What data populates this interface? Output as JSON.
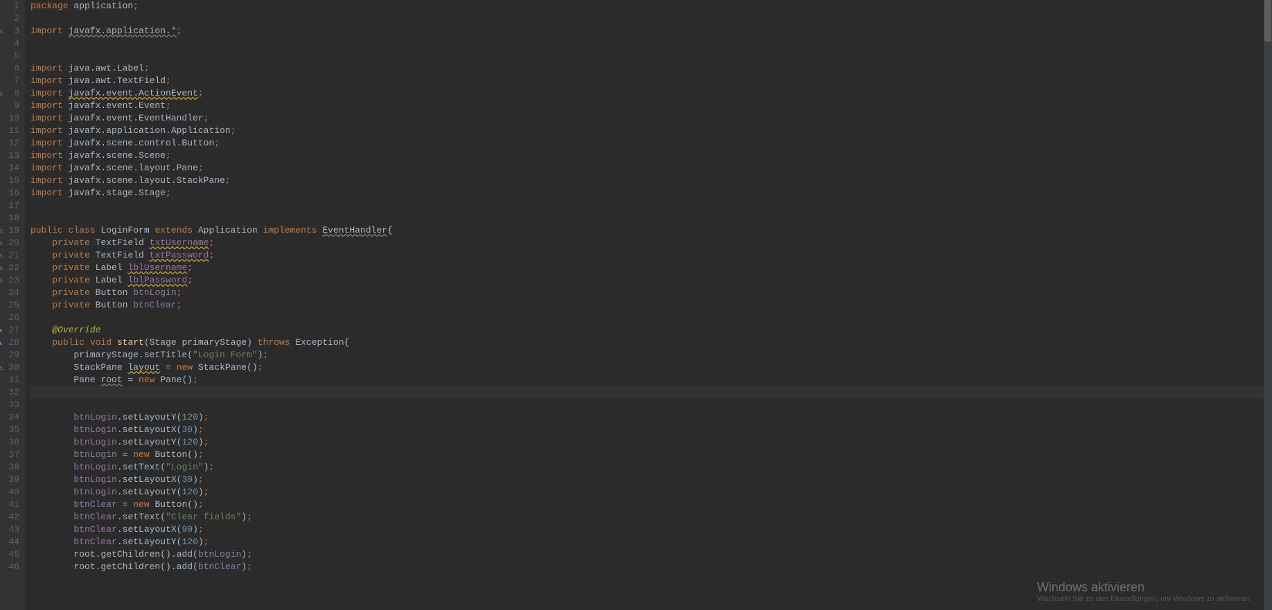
{
  "watermark": {
    "title": "Windows aktivieren",
    "subtitle": "Wechseln Sie zu den Einstellungen, um Windows zu aktivieren."
  },
  "lines": [
    {
      "n": 1,
      "tokens": [
        {
          "t": "package ",
          "c": "kw"
        },
        {
          "t": "application",
          "c": "type"
        },
        {
          "t": ";",
          "c": "semi"
        }
      ]
    },
    {
      "n": 2,
      "tokens": []
    },
    {
      "n": 3,
      "icon": "warn breakpoint",
      "tokens": [
        {
          "t": "import ",
          "c": "kw"
        },
        {
          "t": "javafx.application.*",
          "c": "underline"
        },
        {
          "t": ";",
          "c": "semi"
        }
      ]
    },
    {
      "n": 4,
      "tokens": []
    },
    {
      "n": 5,
      "tokens": []
    },
    {
      "n": 6,
      "tokens": [
        {
          "t": "import ",
          "c": "kw"
        },
        {
          "t": "java.awt.Label",
          "c": "type"
        },
        {
          "t": ";",
          "c": "semi"
        }
      ]
    },
    {
      "n": 7,
      "tokens": [
        {
          "t": "import ",
          "c": "kw"
        },
        {
          "t": "java.awt.TextField",
          "c": "type"
        },
        {
          "t": ";",
          "c": "semi"
        }
      ]
    },
    {
      "n": 8,
      "icon": "warn",
      "tokens": [
        {
          "t": "import ",
          "c": "kw"
        },
        {
          "t": "javafx.event.ActionEvent",
          "c": "underline-warn"
        },
        {
          "t": ";",
          "c": "semi"
        }
      ]
    },
    {
      "n": 9,
      "tokens": [
        {
          "t": "import ",
          "c": "kw"
        },
        {
          "t": "javafx.event.Event",
          "c": "type"
        },
        {
          "t": ";",
          "c": "semi"
        }
      ]
    },
    {
      "n": 10,
      "tokens": [
        {
          "t": "import ",
          "c": "kw"
        },
        {
          "t": "javafx.event.EventHandler",
          "c": "type"
        },
        {
          "t": ";",
          "c": "semi"
        }
      ]
    },
    {
      "n": 11,
      "tokens": [
        {
          "t": "import ",
          "c": "kw"
        },
        {
          "t": "javafx.application.Application",
          "c": "type"
        },
        {
          "t": ";",
          "c": "semi"
        }
      ]
    },
    {
      "n": 12,
      "tokens": [
        {
          "t": "import ",
          "c": "kw"
        },
        {
          "t": "javafx.scene.control.Button",
          "c": "type"
        },
        {
          "t": ";",
          "c": "semi"
        }
      ]
    },
    {
      "n": 13,
      "tokens": [
        {
          "t": "import ",
          "c": "kw"
        },
        {
          "t": "javafx.scene.Scene",
          "c": "type"
        },
        {
          "t": ";",
          "c": "semi"
        }
      ]
    },
    {
      "n": 14,
      "tokens": [
        {
          "t": "import ",
          "c": "kw"
        },
        {
          "t": "javafx.scene.layout.Pane",
          "c": "type"
        },
        {
          "t": ";",
          "c": "semi"
        }
      ]
    },
    {
      "n": 15,
      "tokens": [
        {
          "t": "import ",
          "c": "kw"
        },
        {
          "t": "javafx.scene.layout.StackPane",
          "c": "type"
        },
        {
          "t": ";",
          "c": "semi"
        }
      ]
    },
    {
      "n": 16,
      "tokens": [
        {
          "t": "import ",
          "c": "kw"
        },
        {
          "t": "javafx.stage.Stage",
          "c": "type"
        },
        {
          "t": ";",
          "c": "semi"
        }
      ]
    },
    {
      "n": 17,
      "tokens": []
    },
    {
      "n": 18,
      "tokens": []
    },
    {
      "n": 19,
      "icon": "warn",
      "tokens": [
        {
          "t": "public class ",
          "c": "kw"
        },
        {
          "t": "LoginForm ",
          "c": "classname"
        },
        {
          "t": "extends ",
          "c": "kw"
        },
        {
          "t": "Application ",
          "c": "classname"
        },
        {
          "t": "implements ",
          "c": "kw"
        },
        {
          "t": "EventHandler",
          "c": "underline"
        },
        {
          "t": "{",
          "c": "paren"
        }
      ]
    },
    {
      "n": 20,
      "icon": "warn",
      "tokens": [
        {
          "t": "    ",
          "c": ""
        },
        {
          "t": "private ",
          "c": "kw"
        },
        {
          "t": "TextField ",
          "c": "classname"
        },
        {
          "t": "txtUsername",
          "c": "field underline-warn"
        },
        {
          "t": ";",
          "c": "semi"
        }
      ]
    },
    {
      "n": 21,
      "icon": "warn",
      "tokens": [
        {
          "t": "    ",
          "c": ""
        },
        {
          "t": "private ",
          "c": "kw"
        },
        {
          "t": "TextField ",
          "c": "classname"
        },
        {
          "t": "txtPassword",
          "c": "field underline-warn"
        },
        {
          "t": ";",
          "c": "semi"
        }
      ]
    },
    {
      "n": 22,
      "icon": "warn",
      "tokens": [
        {
          "t": "    ",
          "c": ""
        },
        {
          "t": "private ",
          "c": "kw"
        },
        {
          "t": "Label ",
          "c": "classname"
        },
        {
          "t": "lblUsername",
          "c": "field underline-warn"
        },
        {
          "t": ";",
          "c": "semi"
        }
      ]
    },
    {
      "n": 23,
      "icon": "warn",
      "tokens": [
        {
          "t": "    ",
          "c": ""
        },
        {
          "t": "private ",
          "c": "kw"
        },
        {
          "t": "Label ",
          "c": "classname"
        },
        {
          "t": "lblPassword",
          "c": "field underline-warn"
        },
        {
          "t": ";",
          "c": "semi"
        }
      ]
    },
    {
      "n": 24,
      "tokens": [
        {
          "t": "    ",
          "c": ""
        },
        {
          "t": "private ",
          "c": "kw"
        },
        {
          "t": "Button ",
          "c": "classname"
        },
        {
          "t": "btnLogin",
          "c": "field"
        },
        {
          "t": ";",
          "c": "semi"
        }
      ]
    },
    {
      "n": 25,
      "tokens": [
        {
          "t": "    ",
          "c": ""
        },
        {
          "t": "private ",
          "c": "kw"
        },
        {
          "t": "Button ",
          "c": "classname"
        },
        {
          "t": "btnClear",
          "c": "field"
        },
        {
          "t": ";",
          "c": "semi"
        }
      ]
    },
    {
      "n": 26,
      "tokens": []
    },
    {
      "n": 27,
      "icon": "breakpoint",
      "tokens": [
        {
          "t": "    ",
          "c": ""
        },
        {
          "t": "@Override",
          "c": "annotation"
        }
      ]
    },
    {
      "n": 28,
      "icon": "override",
      "tokens": [
        {
          "t": "    ",
          "c": ""
        },
        {
          "t": "public void ",
          "c": "kw"
        },
        {
          "t": "start",
          "c": "method"
        },
        {
          "t": "(",
          "c": "paren"
        },
        {
          "t": "Stage ",
          "c": "classname"
        },
        {
          "t": "primaryStage",
          "c": "param"
        },
        {
          "t": ") ",
          "c": "paren"
        },
        {
          "t": "throws ",
          "c": "kw"
        },
        {
          "t": "Exception",
          "c": "classname"
        },
        {
          "t": "{",
          "c": "paren"
        }
      ]
    },
    {
      "n": 29,
      "tokens": [
        {
          "t": "        primaryStage.setTitle(",
          "c": "type"
        },
        {
          "t": "\"Login Form\"",
          "c": "string"
        },
        {
          "t": ")",
          "c": "paren"
        },
        {
          "t": ";",
          "c": "semi"
        }
      ]
    },
    {
      "n": 30,
      "icon": "warn",
      "tokens": [
        {
          "t": "        StackPane ",
          "c": "type"
        },
        {
          "t": "layout",
          "c": "underline-warn"
        },
        {
          "t": " = ",
          "c": "op"
        },
        {
          "t": "new ",
          "c": "kw"
        },
        {
          "t": "StackPane()",
          "c": "type"
        },
        {
          "t": ";",
          "c": "semi"
        }
      ]
    },
    {
      "n": 31,
      "tokens": [
        {
          "t": "        Pane ",
          "c": "type"
        },
        {
          "t": "root",
          "c": "underline"
        },
        {
          "t": " = ",
          "c": "op"
        },
        {
          "t": "new ",
          "c": "kw"
        },
        {
          "t": "Pane()",
          "c": "type"
        },
        {
          "t": ";",
          "c": "semi"
        }
      ]
    },
    {
      "n": 32,
      "current": true,
      "tokens": [
        {
          "t": "        ",
          "c": ""
        }
      ]
    },
    {
      "n": 33,
      "tokens": []
    },
    {
      "n": 34,
      "tokens": [
        {
          "t": "        ",
          "c": ""
        },
        {
          "t": "btnLogin",
          "c": "field"
        },
        {
          "t": ".setLayoutY(",
          "c": "type"
        },
        {
          "t": "120",
          "c": "number"
        },
        {
          "t": ")",
          "c": "paren"
        },
        {
          "t": ";",
          "c": "semi"
        }
      ]
    },
    {
      "n": 35,
      "tokens": [
        {
          "t": "        ",
          "c": ""
        },
        {
          "t": "btnLogin",
          "c": "field"
        },
        {
          "t": ".setLayoutX(",
          "c": "type"
        },
        {
          "t": "30",
          "c": "number"
        },
        {
          "t": ")",
          "c": "paren"
        },
        {
          "t": ";",
          "c": "semi"
        }
      ]
    },
    {
      "n": 36,
      "tokens": [
        {
          "t": "        ",
          "c": ""
        },
        {
          "t": "btnLogin",
          "c": "field"
        },
        {
          "t": ".setLayoutY(",
          "c": "type"
        },
        {
          "t": "120",
          "c": "number"
        },
        {
          "t": ")",
          "c": "paren"
        },
        {
          "t": ";",
          "c": "semi"
        }
      ]
    },
    {
      "n": 37,
      "tokens": [
        {
          "t": "        ",
          "c": ""
        },
        {
          "t": "btnLogin",
          "c": "field"
        },
        {
          "t": " = ",
          "c": "op"
        },
        {
          "t": "new ",
          "c": "kw"
        },
        {
          "t": "Button()",
          "c": "type"
        },
        {
          "t": ";",
          "c": "semi"
        }
      ]
    },
    {
      "n": 38,
      "tokens": [
        {
          "t": "        ",
          "c": ""
        },
        {
          "t": "btnLogin",
          "c": "field"
        },
        {
          "t": ".setText(",
          "c": "type"
        },
        {
          "t": "\"Login\"",
          "c": "string"
        },
        {
          "t": ")",
          "c": "paren"
        },
        {
          "t": ";",
          "c": "semi"
        }
      ]
    },
    {
      "n": 39,
      "tokens": [
        {
          "t": "        ",
          "c": ""
        },
        {
          "t": "btnLogin",
          "c": "field"
        },
        {
          "t": ".setLayoutX(",
          "c": "type"
        },
        {
          "t": "30",
          "c": "number"
        },
        {
          "t": ")",
          "c": "paren"
        },
        {
          "t": ";",
          "c": "semi"
        }
      ]
    },
    {
      "n": 40,
      "tokens": [
        {
          "t": "        ",
          "c": ""
        },
        {
          "t": "btnLogin",
          "c": "field"
        },
        {
          "t": ".setLayoutY(",
          "c": "type"
        },
        {
          "t": "120",
          "c": "number"
        },
        {
          "t": ")",
          "c": "paren"
        },
        {
          "t": ";",
          "c": "semi"
        }
      ]
    },
    {
      "n": 41,
      "tokens": [
        {
          "t": "        ",
          "c": ""
        },
        {
          "t": "btnClear",
          "c": "field"
        },
        {
          "t": " = ",
          "c": "op"
        },
        {
          "t": "new ",
          "c": "kw"
        },
        {
          "t": "Button()",
          "c": "type"
        },
        {
          "t": ";",
          "c": "semi"
        }
      ]
    },
    {
      "n": 42,
      "tokens": [
        {
          "t": "        ",
          "c": ""
        },
        {
          "t": "btnClear",
          "c": "field"
        },
        {
          "t": ".setText(",
          "c": "type"
        },
        {
          "t": "\"Clear fields\"",
          "c": "string"
        },
        {
          "t": ")",
          "c": "paren"
        },
        {
          "t": ";",
          "c": "semi"
        }
      ]
    },
    {
      "n": 43,
      "tokens": [
        {
          "t": "        ",
          "c": ""
        },
        {
          "t": "btnClear",
          "c": "field"
        },
        {
          "t": ".setLayoutX(",
          "c": "type"
        },
        {
          "t": "90",
          "c": "number"
        },
        {
          "t": ")",
          "c": "paren"
        },
        {
          "t": ";",
          "c": "semi"
        }
      ]
    },
    {
      "n": 44,
      "tokens": [
        {
          "t": "        ",
          "c": ""
        },
        {
          "t": "btnClear",
          "c": "field"
        },
        {
          "t": ".setLayoutY(",
          "c": "type"
        },
        {
          "t": "120",
          "c": "number"
        },
        {
          "t": ")",
          "c": "paren"
        },
        {
          "t": ";",
          "c": "semi"
        }
      ]
    },
    {
      "n": 45,
      "tokens": [
        {
          "t": "        root.getChildren().add(",
          "c": "type"
        },
        {
          "t": "btnLogin",
          "c": "field"
        },
        {
          "t": ")",
          "c": "paren"
        },
        {
          "t": ";",
          "c": "semi"
        }
      ]
    },
    {
      "n": 46,
      "tokens": [
        {
          "t": "        root.getChildren().add(",
          "c": "type"
        },
        {
          "t": "btnClear",
          "c": "field"
        },
        {
          "t": ")",
          "c": "paren"
        },
        {
          "t": ";",
          "c": "semi"
        }
      ]
    }
  ]
}
